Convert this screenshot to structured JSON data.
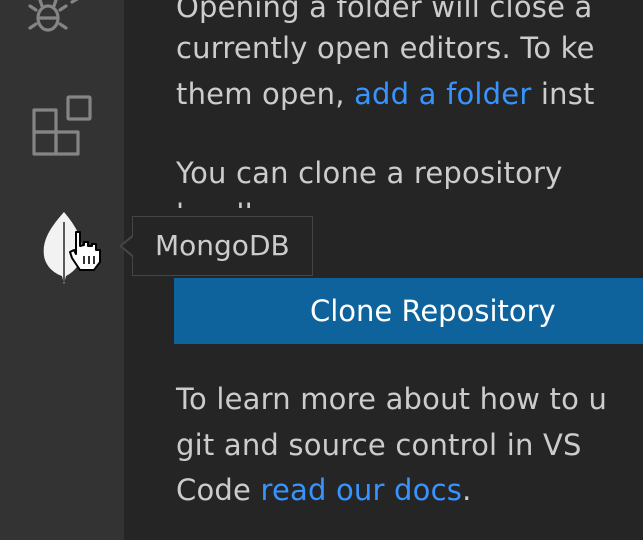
{
  "colors": {
    "activity_bar_bg": "#333333",
    "panel_bg": "#252526",
    "text": "#cccccc",
    "link": "#3794ff",
    "button_bg": "#0e639c",
    "button_text": "#ffffff"
  },
  "activity_bar": {
    "items": [
      {
        "icon": "debug-icon"
      },
      {
        "icon": "extensions-icon"
      },
      {
        "icon": "mongodb-leaf-icon"
      }
    ]
  },
  "tooltip": {
    "label": "MongoDB"
  },
  "welcome": {
    "para1": {
      "line1": "Opening a folder will close a",
      "line2": "currently open editors. To ke",
      "line3_pre": "them open, ",
      "line3_link": "add a folder",
      "line3_post": " inst"
    },
    "para2": {
      "line1": "You can clone a repository",
      "line2": "locally."
    },
    "clone_button_label": "Clone Repository",
    "para3": {
      "line1": "To learn more about how to u",
      "line2": "git and source control in VS",
      "line3_pre": "Code ",
      "line3_link": "read our docs",
      "line3_post": "."
    }
  }
}
